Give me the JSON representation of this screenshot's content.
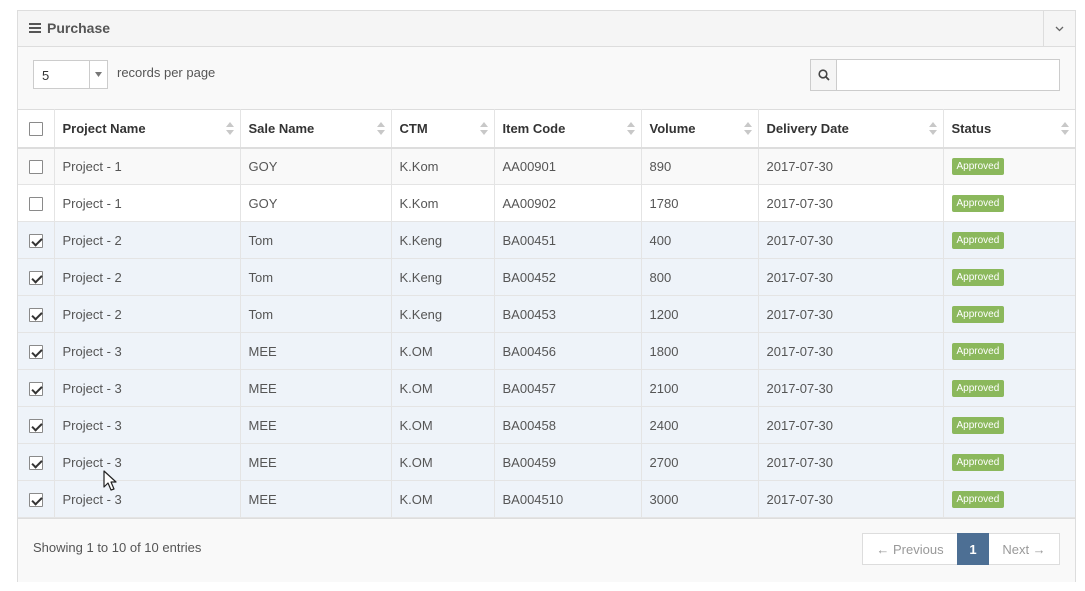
{
  "panel": {
    "title": "Purchase"
  },
  "toolbar": {
    "page_size": "5",
    "records_label": "records per page",
    "search_placeholder": ""
  },
  "table": {
    "columns": [
      "Project Name",
      "Sale Name",
      "CTM",
      "Item Code",
      "Volume",
      "Delivery Date",
      "Status"
    ],
    "rows": [
      {
        "checked": false,
        "project": "Project - 1",
        "sale": "GOY",
        "ctm": "K.Kom",
        "item": "AA00901",
        "volume": "890",
        "date": "2017-07-30",
        "status": "Approved"
      },
      {
        "checked": false,
        "project": "Project - 1",
        "sale": "GOY",
        "ctm": "K.Kom",
        "item": "AA00902",
        "volume": "1780",
        "date": "2017-07-30",
        "status": "Approved"
      },
      {
        "checked": true,
        "project": "Project - 2",
        "sale": "Tom",
        "ctm": "K.Keng",
        "item": "BA00451",
        "volume": "400",
        "date": "2017-07-30",
        "status": "Approved"
      },
      {
        "checked": true,
        "project": "Project - 2",
        "sale": "Tom",
        "ctm": "K.Keng",
        "item": "BA00452",
        "volume": "800",
        "date": "2017-07-30",
        "status": "Approved"
      },
      {
        "checked": true,
        "project": "Project - 2",
        "sale": "Tom",
        "ctm": "K.Keng",
        "item": "BA00453",
        "volume": "1200",
        "date": "2017-07-30",
        "status": "Approved"
      },
      {
        "checked": true,
        "project": "Project - 3",
        "sale": "MEE",
        "ctm": "K.OM",
        "item": "BA00456",
        "volume": "1800",
        "date": "2017-07-30",
        "status": "Approved"
      },
      {
        "checked": true,
        "project": "Project - 3",
        "sale": "MEE",
        "ctm": "K.OM",
        "item": "BA00457",
        "volume": "2100",
        "date": "2017-07-30",
        "status": "Approved"
      },
      {
        "checked": true,
        "project": "Project - 3",
        "sale": "MEE",
        "ctm": "K.OM",
        "item": "BA00458",
        "volume": "2400",
        "date": "2017-07-30",
        "status": "Approved"
      },
      {
        "checked": true,
        "project": "Project - 3",
        "sale": "MEE",
        "ctm": "K.OM",
        "item": "BA00459",
        "volume": "2700",
        "date": "2017-07-30",
        "status": "Approved"
      },
      {
        "checked": true,
        "project": "Project - 3",
        "sale": "MEE",
        "ctm": "K.OM",
        "item": "BA004510",
        "volume": "3000",
        "date": "2017-07-30",
        "status": "Approved"
      }
    ]
  },
  "footer": {
    "info": "Showing 1 to 10 of 10 entries",
    "prev_label": "← Previous",
    "current_page": "1",
    "next_label": "Next →"
  },
  "icons": {
    "menu": "hamburger-icon",
    "collapse": "chevron-down-icon",
    "search": "search-icon",
    "sort": "sort-both-icon"
  },
  "colors": {
    "status_badge": "#8bb85c",
    "active_page": "#4d6f94",
    "selected_row": "#eef3f9"
  }
}
